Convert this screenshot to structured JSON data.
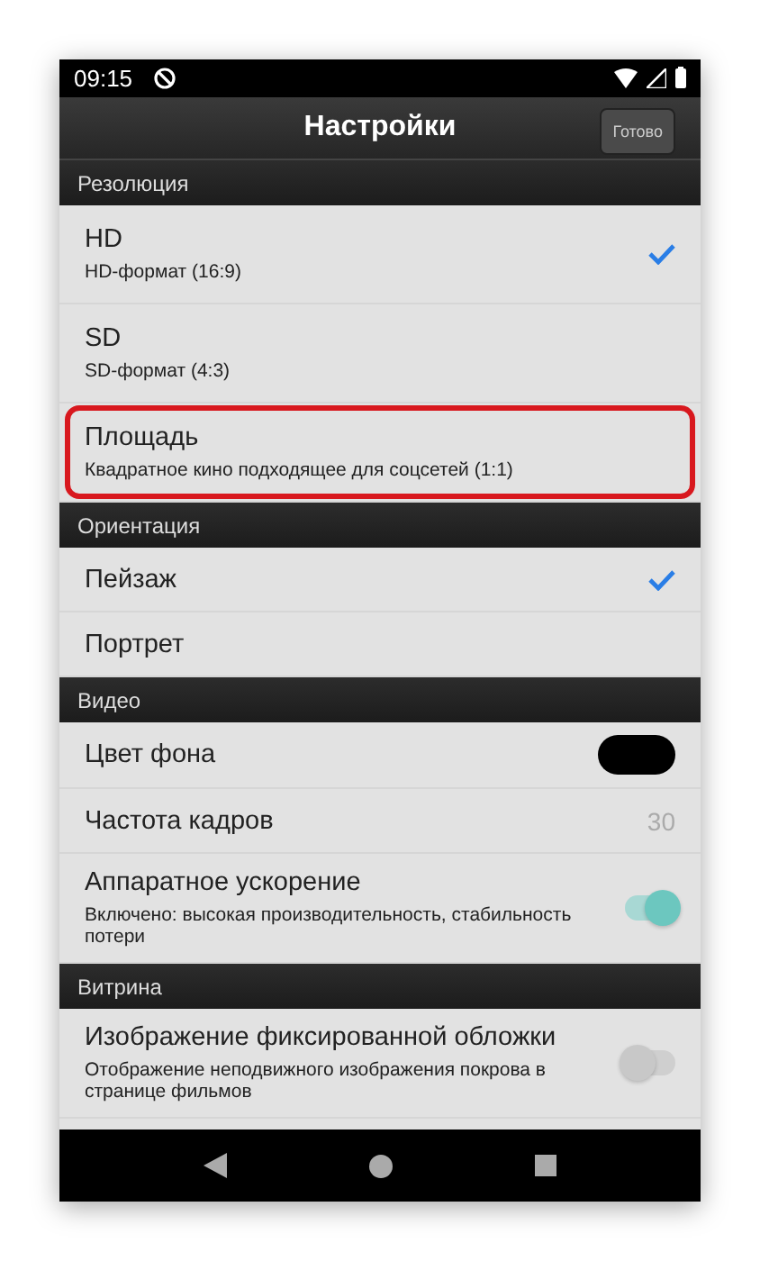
{
  "status_bar": {
    "time": "09:15"
  },
  "app_bar": {
    "title": "Настройки",
    "done_button": "Готово"
  },
  "sections": [
    {
      "title": "Резолюция",
      "items": [
        {
          "kind": "choice",
          "title": "HD",
          "subtitle": "HD-формат (16:9)",
          "selected": true,
          "highlighted": false
        },
        {
          "kind": "choice",
          "title": "SD",
          "subtitle": "SD-формат (4:3)",
          "selected": false,
          "highlighted": false
        },
        {
          "kind": "choice",
          "title": "Площадь",
          "subtitle": "Квадратное кино подходящее для соцсетей (1:1)",
          "selected": false,
          "highlighted": true
        }
      ]
    },
    {
      "title": "Ориентация",
      "items": [
        {
          "kind": "choice",
          "title": "Пейзаж",
          "selected": true,
          "highlighted": false
        },
        {
          "kind": "choice",
          "title": "Портрет",
          "selected": false,
          "highlighted": false
        }
      ]
    },
    {
      "title": "Видео",
      "items": [
        {
          "kind": "color",
          "title": "Цвет фона",
          "color": "#000000",
          "highlighted": false
        },
        {
          "kind": "value",
          "title": "Частота кадров",
          "value": "30",
          "highlighted": false
        },
        {
          "kind": "toggle",
          "title": "Аппаратное ускорение",
          "subtitle": "Включено: высокая производительность, стабильность потери",
          "on": true,
          "highlighted": false
        }
      ]
    },
    {
      "title": "Витрина",
      "items": [
        {
          "kind": "toggle",
          "title": "Изображение фиксированной обложки",
          "subtitle": "Отображение неподвижного изображения покрова в странице фильмов",
          "on": false,
          "highlighted": false
        }
      ]
    }
  ]
}
